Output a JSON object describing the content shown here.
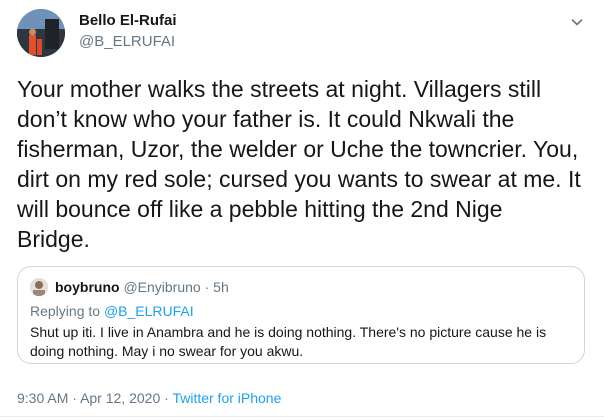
{
  "author": {
    "name": "Bello El-Rufai",
    "handle": "@B_ELRUFAI"
  },
  "tweet": {
    "text": "Your mother walks the streets at night. Villagers still\ndon’t know who your father is. It could Nkwali the\nfisherman, Uzor, the welder or Uche the towncrier. You,\ndirt on my red sole; cursed you wants to swear at me. It\nwill bounce off like a pebble hitting the 2nd Nige\nBridge."
  },
  "quoted": {
    "name": "boybruno",
    "handle": "@Enyibruno",
    "separator": "·",
    "time": "5h",
    "replying_prefix": "Replying to",
    "replying_handle": "@B_ELRUFAI",
    "text": "Shut up iti. I live in Anambra and he is doing nothing. There's no picture cause he is doing nothing. May i no swear for you akwu."
  },
  "meta": {
    "time": "9:30 AM",
    "separator": "·",
    "date": "Apr 12, 2020",
    "source": "Twitter for iPhone"
  },
  "icons": {
    "avatar": "profile-photo",
    "menu": "chevron-down-icon",
    "quoted_avatar": "profile-photo"
  },
  "colors": {
    "text": "#14171a",
    "secondary": "#657786",
    "link": "#1da1f2",
    "border": "#ccd6dd"
  }
}
